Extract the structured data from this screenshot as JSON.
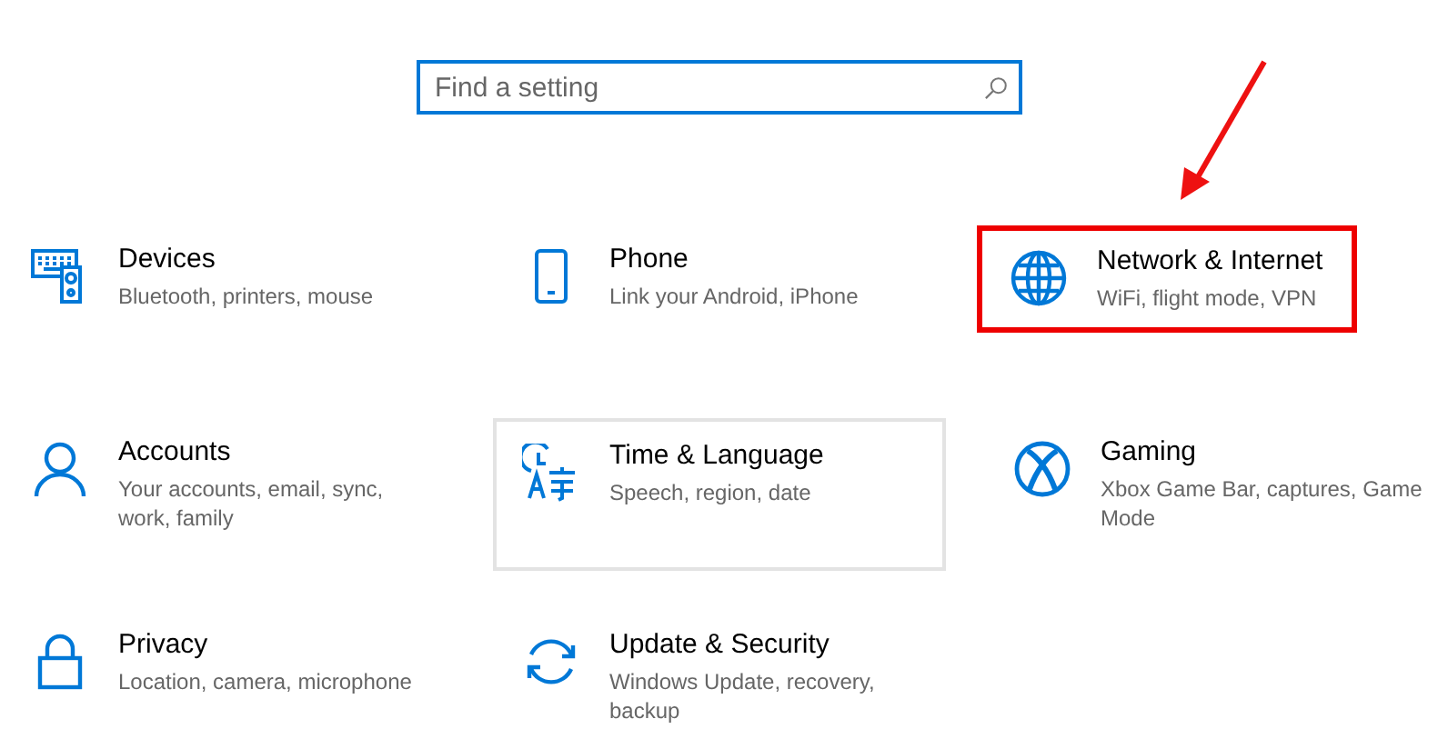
{
  "search": {
    "placeholder": "Find a setting"
  },
  "tiles": [
    {
      "title": "Devices",
      "description": "Bluetooth, printers, mouse",
      "hovered": false,
      "highlighted": false
    },
    {
      "title": "Phone",
      "description": "Link your Android, iPhone",
      "hovered": false,
      "highlighted": false
    },
    {
      "title": "Network & Internet",
      "description": "WiFi, flight mode, VPN",
      "hovered": false,
      "highlighted": true
    },
    {
      "title": "Accounts",
      "description": "Your accounts, email, sync, work, family",
      "hovered": false,
      "highlighted": false
    },
    {
      "title": "Time & Language",
      "description": "Speech, region, date",
      "hovered": true,
      "highlighted": false
    },
    {
      "title": "Gaming",
      "description": "Xbox Game Bar, captures, Game Mode",
      "hovered": false,
      "highlighted": false
    },
    {
      "title": "Privacy",
      "description": "Location, camera, microphone",
      "hovered": false,
      "highlighted": false
    },
    {
      "title": "Update & Security",
      "description": "Windows Update, recovery, backup",
      "hovered": false,
      "highlighted": false
    }
  ]
}
